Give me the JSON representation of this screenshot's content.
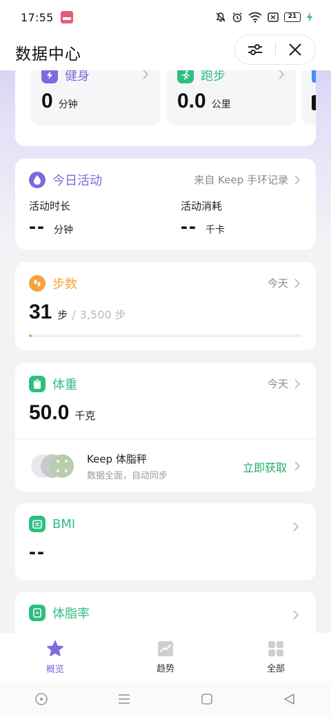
{
  "status_bar": {
    "time": "17:55",
    "battery_level": "21"
  },
  "header": {
    "title": "数据中心"
  },
  "top_cards": [
    {
      "label": "健身",
      "value": "0",
      "unit": "分钟",
      "color": "#7b6bde"
    },
    {
      "label": "跑步",
      "value": "0.0",
      "unit": "公里",
      "color": "#2dbf7f"
    }
  ],
  "activity": {
    "title": "今日活动",
    "source_label": "来自 Keep 手环记录",
    "duration_label": "活动时长",
    "duration_value": "--",
    "duration_unit": "分钟",
    "consume_label": "活动消耗",
    "consume_value": "--",
    "consume_unit": "千卡",
    "color": "#7b6bde"
  },
  "steps": {
    "title": "步数",
    "period": "今天",
    "value": "31",
    "unit": "步",
    "separator": "/",
    "goal": "3,500 步",
    "progress": 0.009,
    "color": "#f5a43c"
  },
  "weight": {
    "title": "体重",
    "period": "今天",
    "value": "50.0",
    "unit": "千克",
    "color": "#2dbf7f",
    "promo_title": "Keep 体脂秤",
    "promo_sub": "数据全面，自动同步",
    "promo_action": "立即获取"
  },
  "bmi": {
    "title": "BMI",
    "value": "--",
    "color": "#2dbf7f"
  },
  "body_fat": {
    "title": "体脂率",
    "color": "#2dbf7f"
  },
  "tabs": [
    {
      "label": "概览",
      "active": true
    },
    {
      "label": "趋势",
      "active": false
    },
    {
      "label": "全部",
      "active": false
    }
  ],
  "colors": {
    "accent": "#7a6be0",
    "action_green": "#1fae6b"
  }
}
